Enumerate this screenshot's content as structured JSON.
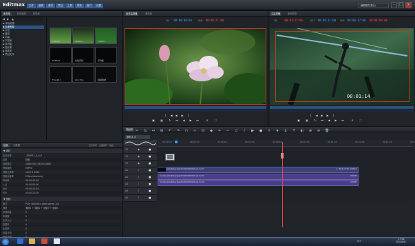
{
  "app": {
    "title": "Editmax"
  },
  "menu": [
    "文件",
    "编辑",
    "素材",
    "项目",
    "工具",
    "帮助",
    "窗口",
    "设置"
  ],
  "top_right": {
    "workspace_label": "编辑模式(默认)",
    "min": "–",
    "max": "□",
    "close": "×"
  },
  "left_top_panel": {
    "tabs": [
      "素材库",
      "特效素材",
      "转场库"
    ],
    "tree": [
      "◆ 本地资源",
      "  ▪ 本地资源",
      "  ▪ 片段",
      "  ▪ 音频",
      "  ▪ 字幕",
      "  ▪ 字幕库",
      "  ▪ 序列集",
      "  ▪ 图片集",
      "  ▪ 收藏夹",
      "  ▪ 项目文件"
    ],
    "thumbs": [
      "FSPP01",
      "FSPP02",
      "FSPP03",
      "FSPP04",
      "片段序列",
      "序列集",
      "Fmo16_t",
      "Cnt_fmo",
      "视频素材"
    ]
  },
  "left_bottom_panel": {
    "tabs": [
      "信息",
      "元数据"
    ],
    "header_right": "显示所有 · 全部展开 · 收起",
    "section1_title": "▼ 素材",
    "rows": [
      {
        "k": "素材名称",
        "v": "_FSPP01_0_0_P"
      },
      {
        "k": "类型",
        "v": "视频"
      },
      {
        "k": "视频格式",
        "v": "1080i 50i (1920×1080)"
      },
      {
        "k": "视频编码",
        "v": "MJPEG"
      },
      {
        "k": "视频分辨率",
        "v": "1920 X 1080"
      },
      {
        "k": "视频帧速率",
        "v": "25fps(interlace)"
      },
      {
        "k": "时间码",
        "v": "00:00:00:00"
      },
      {
        "k": "入点",
        "v": "00:00:00:00"
      },
      {
        "k": "出点",
        "v": "00:00:21:04"
      },
      {
        "k": "时长",
        "v": "00:00:21:05"
      }
    ],
    "section2_title": "▼ 音频",
    "rows2": [
      {
        "k": "格式",
        "v": "PCM 48000Hz 16bit stereo 2ch"
      },
      {
        "k": "通道",
        "v": "通道1 + 通道2 + 通道3 + 通道4"
      },
      {
        "k": "采样精度",
        "v": "0"
      },
      {
        "k": "声道数",
        "v": "0"
      },
      {
        "k": "文件大小",
        "v": "0"
      },
      {
        "k": "数据率",
        "v": "0"
      },
      {
        "k": "比特率",
        "v": "0"
      },
      {
        "k": "创建日期",
        "v": "0"
      },
      {
        "k": "修改日期",
        "v": "0"
      }
    ]
  },
  "source_monitor": {
    "tabs": [
      "素材监视器",
      "素材库"
    ],
    "tc_in_label": "IN",
    "tc_in": "00:00:00:00",
    "tc_dur_label": "DUR",
    "tc_dur": "00:00:21:00"
  },
  "program_monitor": {
    "tabs": [
      "主监视器",
      "素材预览"
    ],
    "tc_in_label": "IN",
    "tc_in": "00:03:22:06",
    "tc_out_label": "OUT",
    "tc_out": "00:00:31:00",
    "tc_dur_label": "DUR",
    "tc_dur": "00:00:37:00",
    "tc_end": "00:00:00:00",
    "overlay_tc": "00:01:14"
  },
  "timeline": {
    "title": "时间线",
    "seq_tab": "序列 1 ×",
    "tracks": [
      "V3",
      "V2",
      "V1",
      "A1",
      "A2",
      "A3",
      "A4",
      "A5"
    ],
    "clip_v1_label": "CiarfanaDeRiberaJantzik02060909-a1 bch1",
    "clip_v1_right": "1 (5k2) [10K 1080i]",
    "clip_a1_label": "CiarfanaDeRiberaJantzik02060909-a1 bch1",
    "clip_a2_label": "CiarfanaDeRiberaJantzik02060909-a1 bch2",
    "clip_a_right": "MUSE",
    "ruler": [
      "00:00:00",
      "00:00:10",
      "00:00:20",
      "00:00:30",
      "00:00:40",
      "00:00:50",
      "00:01:00",
      "00:01:10",
      "00:01:20",
      "00:01:30"
    ]
  },
  "taskbar": {
    "clock_time": "17:01",
    "clock_date": "2012/04/..",
    "lang": "CH"
  },
  "colors": {
    "accent_blue": "#3ea0ff",
    "tc_red": "#ff4f4f",
    "playhead": "#e14a4a",
    "video_clip": "#3b3f7a",
    "audio_clip": "#4a3f86"
  }
}
